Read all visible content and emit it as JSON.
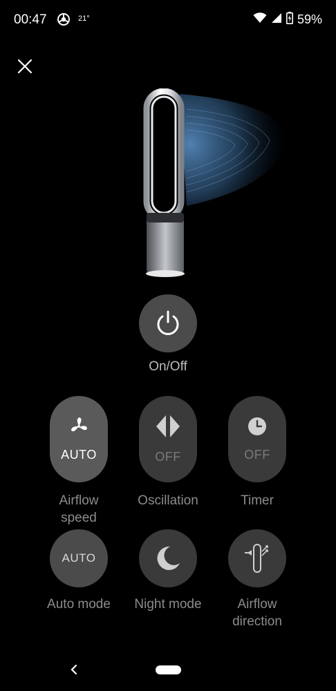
{
  "status": {
    "time": "00:47",
    "temperature": "21°",
    "battery": "59%"
  },
  "controls": {
    "power_label": "On/Off",
    "airflow_speed": {
      "value": "AUTO",
      "label_line1": "Airflow",
      "label_line2": "speed"
    },
    "oscillation": {
      "value": "OFF",
      "label": "Oscillation"
    },
    "timer": {
      "value": "OFF",
      "label": "Timer"
    },
    "auto_mode": {
      "text": "AUTO",
      "label": "Auto mode"
    },
    "night_mode": {
      "label": "Night mode"
    },
    "airflow_direction": {
      "label_line1": "Airflow",
      "label_line2": "direction"
    }
  }
}
